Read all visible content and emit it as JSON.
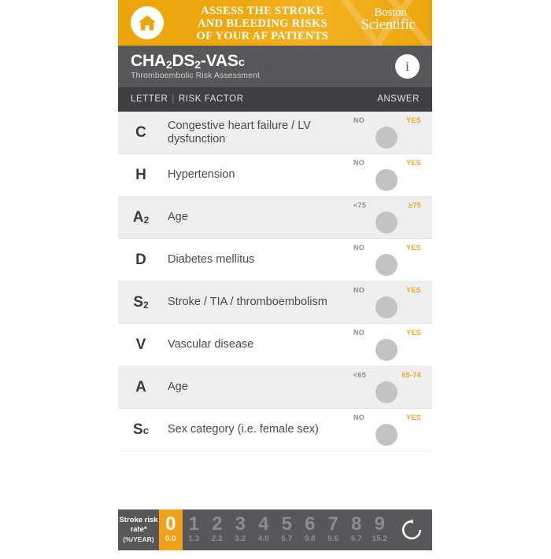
{
  "banner": {
    "home_icon": "home-icon",
    "title_lines": [
      "ASSESS THE STROKE",
      "AND BLEEDING RISKS",
      "OF YOUR AF PATIENTS"
    ],
    "logo_line1": "Boston",
    "logo_line2": "Scientific",
    "background_color": "#eea40c"
  },
  "titlebar": {
    "title_prefix": "CHA",
    "title_sub1": "2",
    "title_mid": "DS",
    "title_sub2": "2",
    "title_suffix": "-VAS",
    "title_sc": "c",
    "subtitle": "Thromboembolic Risk Assessment",
    "info_label": "i",
    "background_color": "#58585a"
  },
  "column_header": {
    "letter": "LETTER",
    "separator": "|",
    "risk_factor": "RISK FACTOR",
    "answer": "ANSWER",
    "background_color": "#3f3f41"
  },
  "rows": [
    {
      "letter": "C",
      "sub": "",
      "factor": "Congestive heart failure / LV dysfunction",
      "no_label": "NO",
      "yes_label": "YES",
      "state": "unset"
    },
    {
      "letter": "H",
      "sub": "",
      "factor": "Hypertension",
      "no_label": "NO",
      "yes_label": "YES",
      "state": "unset"
    },
    {
      "letter": "A",
      "sub": "2",
      "factor": "Age",
      "no_label": "<75",
      "yes_label": "≥75",
      "state": "unset"
    },
    {
      "letter": "D",
      "sub": "",
      "factor": "Diabetes mellitus",
      "no_label": "NO",
      "yes_label": "YES",
      "state": "unset"
    },
    {
      "letter": "S",
      "sub": "2",
      "factor": "Stroke / TIA / thromboembolism",
      "no_label": "NO",
      "yes_label": "YES",
      "state": "unset"
    },
    {
      "letter": "V",
      "sub": "",
      "factor": "Vascular disease",
      "no_label": "NO",
      "yes_label": "YES",
      "state": "unset"
    },
    {
      "letter": "A",
      "sub": "",
      "factor": "Age",
      "no_label": "<65",
      "yes_label": "65-74",
      "state": "unset"
    },
    {
      "letter": "S",
      "sub": "c",
      "factor": "Sex category (i.e. female sex)",
      "no_label": "NO",
      "yes_label": "YES",
      "state": "unset"
    }
  ],
  "scorebar": {
    "label_line1": "Stroke risk",
    "label_line2": "rate*",
    "label_line3": "(%/YEAR)",
    "active_score": 0,
    "accent_color": "#f0a01a",
    "reset_icon": "reset-icon",
    "cells": [
      {
        "score": "0",
        "rate": "0.0"
      },
      {
        "score": "1",
        "rate": "1.3"
      },
      {
        "score": "2",
        "rate": "2.2"
      },
      {
        "score": "3",
        "rate": "3.2"
      },
      {
        "score": "4",
        "rate": "4.0"
      },
      {
        "score": "5",
        "rate": "6.7"
      },
      {
        "score": "6",
        "rate": "9.8"
      },
      {
        "score": "7",
        "rate": "9.6"
      },
      {
        "score": "8",
        "rate": "6.7"
      },
      {
        "score": "9",
        "rate": "15.2"
      }
    ]
  }
}
